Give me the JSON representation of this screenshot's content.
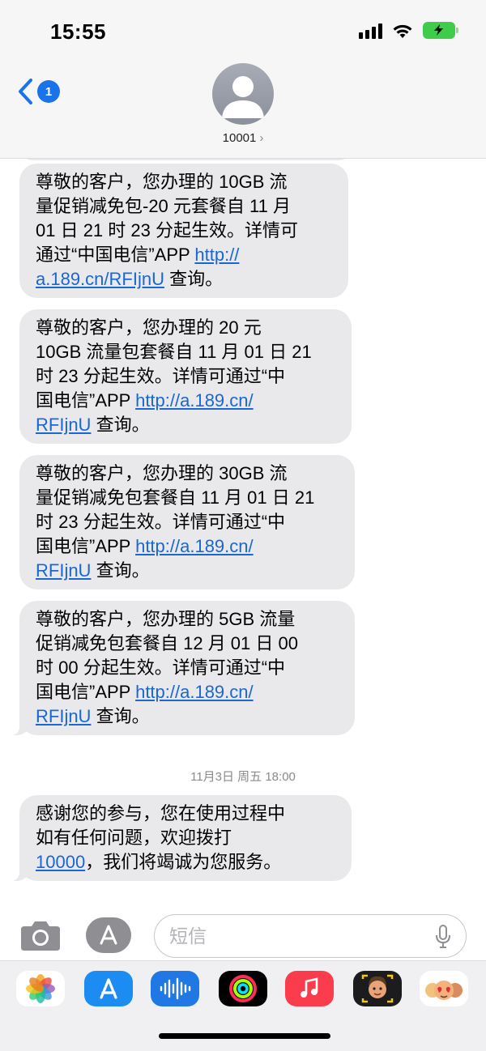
{
  "status": {
    "time": "15:55"
  },
  "header": {
    "back_badge": "1",
    "contact": "10001",
    "contact_chevron": "›"
  },
  "messages": [
    {
      "lines": [
        "尊敬的客户，您办理的 10GB 流",
        "量促销减免包-20 元套餐自 11 月",
        "01 日 21 时 23 分起生效。详情可",
        "通过“中国电信”APP "
      ],
      "link1": "http://",
      "link2": "a.189.cn/RFIjnU",
      "tail": " 查询。"
    },
    {
      "lines": [
        "尊敬的客户，您办理的 20 元",
        "10GB 流量包套餐自 11 月 01 日 21",
        "时 23 分起生效。详情可通过“中",
        "国电信”APP "
      ],
      "link1": "http://a.189.cn/",
      "link2": "RFIjnU",
      "tail": " 查询。"
    },
    {
      "lines": [
        "尊敬的客户，您办理的 30GB 流",
        "量促销减免包套餐自 11 月 01 日 21",
        "时 23 分起生效。详情可通过“中",
        "国电信”APP "
      ],
      "link1": "http://a.189.cn/",
      "link2": "RFIjnU",
      "tail": " 查询。"
    },
    {
      "lines": [
        "尊敬的客户，您办理的 5GB 流量",
        "促销减免包套餐自 12 月 01 日 00",
        "时 00 分起生效。详情可通过“中",
        "国电信”APP "
      ],
      "link1": "http://a.189.cn/",
      "link2": "RFIjnU",
      "tail": " 查询。"
    }
  ],
  "timestamp": "11月3日 周五 18:00",
  "last_message": {
    "line1": "感谢您的参与，您在使用过程中",
    "line2": "如有任何问题，欢迎拨打",
    "phone": "10000",
    "line3_tail": "，我们将竭诚为您服务。"
  },
  "input": {
    "placeholder": "短信"
  },
  "drawer_apps": [
    "photos-icon",
    "app-store-icon",
    "audio-message-icon",
    "activity-icon",
    "music-icon",
    "memoji-icon",
    "memoji-group-icon"
  ],
  "colors": {
    "link": "#1a67d2",
    "bubble": "#e9e9eb",
    "battery": "#3fcc4b",
    "badge": "#1a73e8"
  }
}
